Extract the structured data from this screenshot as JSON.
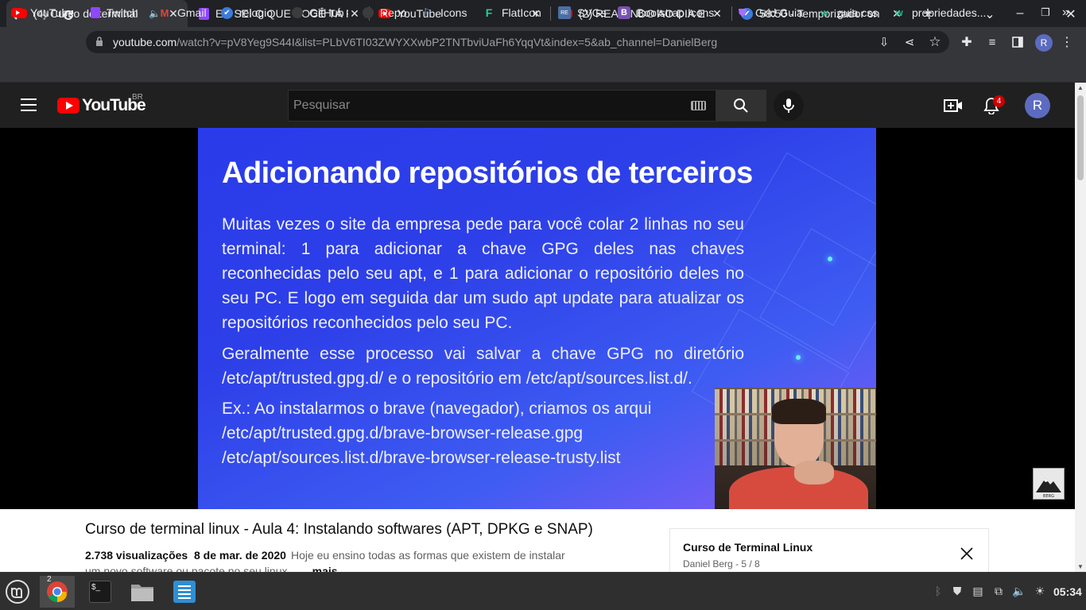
{
  "browser": {
    "tabs": [
      {
        "title": "(4) Curso de terminal",
        "favicon": "youtube-icon",
        "audio": true
      },
      {
        "title": "EU SEI O QUE VOCÊ TÁ F",
        "favicon": "twitch-icon"
      },
      {
        "title": "YouTube",
        "favicon": "youtube-icon"
      },
      {
        "title": "(2) REAGINDO AO DIA E",
        "favicon": "youtube-icon"
      },
      {
        "title": "58:50 - Temporizador on",
        "favicon": "clock-icon"
      }
    ],
    "url_host": "youtube.com",
    "url_path": "/watch?v=pV8Yeg9S44I&list=PLbV6TI03ZWYXXwbP2TNTbviUaFh6YqqVt&index=5&ab_channel=DanielBerg",
    "profile_initial": "R",
    "bookmarks": [
      {
        "label": "YouTube",
        "icon": "youtube-icon"
      },
      {
        "label": "Twitch",
        "icon": "twitch-icon"
      },
      {
        "label": "Gmail",
        "icon": "gmail-icon"
      },
      {
        "label": "relogio",
        "icon": "clock-icon"
      },
      {
        "label": "GitHub",
        "icon": "github-icon"
      },
      {
        "label": "Repo",
        "icon": "github-icon"
      },
      {
        "label": "Icons",
        "icon": "flag-icon"
      },
      {
        "label": "FlatIcon",
        "icon": "flaticon-icon"
      },
      {
        "label": "SVGs",
        "icon": "svgrepo-icon"
      },
      {
        "label": "Bootstrap Icons",
        "icon": "bootstrap-icon"
      },
      {
        "label": "Grid Guia",
        "icon": "shield-icon"
      },
      {
        "label": "guia css",
        "icon": "w-icon"
      },
      {
        "label": "propriedades...",
        "icon": "w-icon"
      }
    ],
    "more_bookmarks": "»"
  },
  "youtube": {
    "logo_text": "YouTube",
    "country": "BR",
    "search_placeholder": "Pesquisar",
    "notification_count": "4",
    "avatar_initial": "R"
  },
  "slide": {
    "title": "Adicionando repositórios de terceiros",
    "paragraph1": "Muitas vezes o site da empresa pede para você colar 2 linhas no seu terminal: 1 para adicionar a chave GPG deles nas chaves reconhecidas pelo seu apt, e 1 para adicionar o repositório deles no seu PC. E logo em seguida dar um sudo apt update para atualizar os repositórios reconhecidos pelo seu PC.",
    "paragraph2": "Geralmente esse processo vai salvar a chave GPG no diretório /etc/apt/trusted.gpg.d/ e o repositório em /etc/apt/sources.list.d/.",
    "paragraph3_line1": "Ex.: Ao instalarmos o brave (navegador), criamos os arqui",
    "paragraph3_line2": "/etc/apt/trusted.gpg.d/brave-browser-release.gpg",
    "paragraph3_line3": "/etc/apt/sources.list.d/brave-browser-release-trusty.list",
    "brand_logo_text": "BERG"
  },
  "video": {
    "title": "Curso de terminal linux - Aula 4: Instalando softwares (APT, DPKG e SNAP)",
    "views": "2.738 visualizações",
    "date": "8 de mar. de 2020",
    "description": "Hoje eu ensino todas as formas que existem de instalar",
    "description_cont": "um novo software ou pacote no seu linux...",
    "more": "mais"
  },
  "playlist": {
    "title": "Curso de Terminal Linux",
    "subtitle": "Daniel Berg - 5 / 8"
  },
  "taskbar": {
    "chrome_badge": "2",
    "time": "05:34"
  }
}
